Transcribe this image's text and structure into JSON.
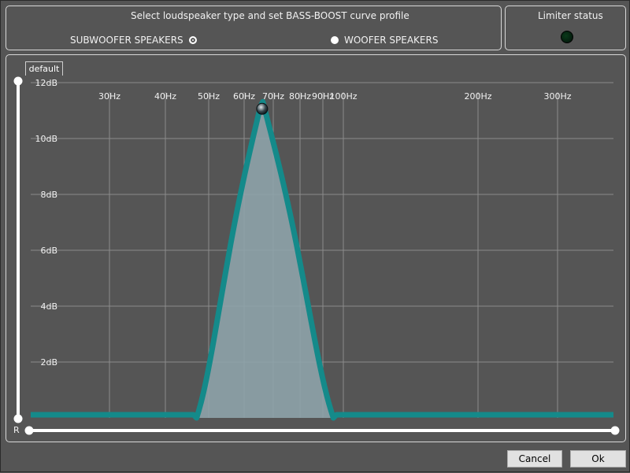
{
  "header": {
    "title": "Select loudspeaker type and set BASS-BOOST curve profile",
    "options": [
      {
        "label": "SUBWOOFER SPEAKERS",
        "selected": true
      },
      {
        "label": "WOOFER SPEAKERS",
        "selected": false
      }
    ]
  },
  "limiter": {
    "title": "Limiter status",
    "led_color": "#0a3a1a"
  },
  "profile_tab": "default",
  "slider_label": "R",
  "buttons": {
    "cancel": "Cancel",
    "ok": "Ok"
  },
  "colors": {
    "curve": "#148a8a",
    "fill": "#8ea3aa",
    "grid": "#8c8c8c"
  },
  "chart_data": {
    "type": "area",
    "x_ticks": [
      "30Hz",
      "40Hz",
      "50Hz",
      "60Hz",
      "70Hz",
      "80Hz",
      "90Hz",
      "100Hz",
      "200Hz",
      "300Hz"
    ],
    "y_ticks": [
      "2dB",
      "4dB",
      "6dB",
      "8dB",
      "10dB",
      "12dB"
    ],
    "ylim": [
      0,
      12
    ],
    "curve": {
      "start_hz": 47,
      "end_hz": 95,
      "peak_hz": 66,
      "peak_db": 11.4
    }
  }
}
